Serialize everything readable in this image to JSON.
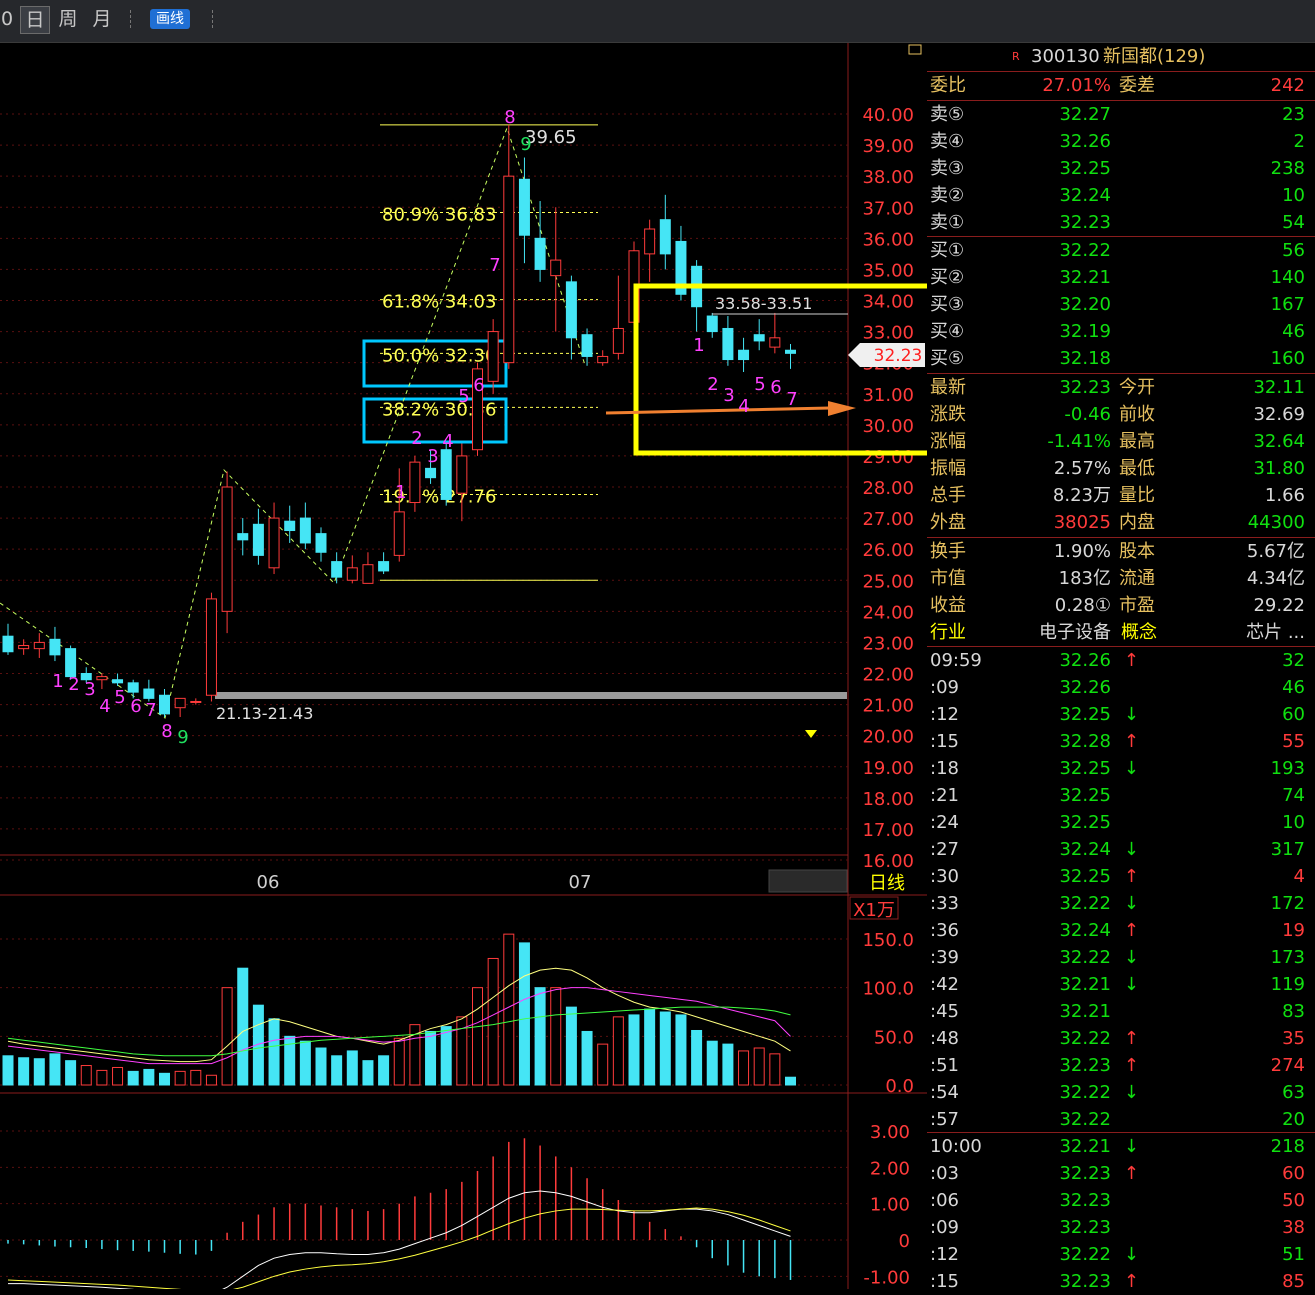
{
  "toolbar": {
    "left_fragment": "0",
    "day": "日",
    "week": "周",
    "month": "月",
    "draw": "画线"
  },
  "chart_data": [
    {
      "type": "candlestick",
      "title": "",
      "yaxis_ticks": [
        "40.00",
        "39.00",
        "38.00",
        "37.00",
        "36.00",
        "35.00",
        "34.00",
        "33.00",
        "32.00",
        "31.00",
        "30.00",
        "29.00",
        "28.00",
        "27.00",
        "26.00",
        "25.00",
        "24.00",
        "23.00",
        "22.00",
        "21.00",
        "20.00",
        "19.00",
        "18.00",
        "17.00",
        "16.00"
      ],
      "ylim": [
        16,
        40
      ],
      "xaxis_labels": [
        "06",
        "07"
      ],
      "period_label": "日线",
      "current_price": "32.23",
      "annotations": {
        "high": "39.65",
        "range_low": "21.13-21.43",
        "range_box": "33.58-33.51",
        "fib": [
          {
            "label": "80.9% 36.83",
            "value": 36.83
          },
          {
            "label": "61.8% 34.03",
            "value": 34.03
          },
          {
            "label": "50.0% 32.30",
            "value": 32.3
          },
          {
            "label": "38.2% 30.56",
            "value": 30.56
          },
          {
            "label": "19.1% 27.76",
            "value": 27.76
          }
        ],
        "count_a": [
          "1",
          "2",
          "3",
          "4",
          "5",
          "6",
          "7",
          "8",
          "9"
        ],
        "count_b": [
          "1",
          "2",
          "3",
          "4",
          "5",
          "6",
          "7",
          "8",
          "9"
        ],
        "count_c": [
          "1",
          "2",
          "3",
          "4",
          "5",
          "6",
          "7"
        ]
      },
      "candles": [
        {
          "o": 23.2,
          "h": 23.6,
          "l": 22.6,
          "c": 22.7
        },
        {
          "o": 22.8,
          "h": 23.1,
          "l": 22.6,
          "c": 22.9
        },
        {
          "o": 22.8,
          "h": 23.3,
          "l": 22.5,
          "c": 23.0
        },
        {
          "o": 23.1,
          "h": 23.5,
          "l": 22.4,
          "c": 22.6
        },
        {
          "o": 22.8,
          "h": 22.9,
          "l": 21.8,
          "c": 21.9
        },
        {
          "o": 22.0,
          "h": 22.2,
          "l": 21.7,
          "c": 21.8
        },
        {
          "o": 21.8,
          "h": 22.0,
          "l": 21.5,
          "c": 21.9
        },
        {
          "o": 21.8,
          "h": 22.0,
          "l": 21.6,
          "c": 21.7
        },
        {
          "o": 21.7,
          "h": 21.8,
          "l": 21.2,
          "c": 21.4
        },
        {
          "o": 21.5,
          "h": 21.8,
          "l": 21.1,
          "c": 21.2
        },
        {
          "o": 21.3,
          "h": 21.5,
          "l": 20.6,
          "c": 20.7
        },
        {
          "o": 20.9,
          "h": 21.2,
          "l": 20.6,
          "c": 21.2
        },
        {
          "o": 21.1,
          "h": 21.2,
          "l": 21.0,
          "c": 21.1
        },
        {
          "o": 21.3,
          "h": 24.6,
          "l": 21.1,
          "c": 24.4
        },
        {
          "o": 24.0,
          "h": 28.5,
          "l": 23.3,
          "c": 28.0
        },
        {
          "o": 26.5,
          "h": 27.0,
          "l": 25.8,
          "c": 26.3
        },
        {
          "o": 26.8,
          "h": 27.3,
          "l": 25.5,
          "c": 25.8
        },
        {
          "o": 25.4,
          "h": 27.5,
          "l": 25.2,
          "c": 27.0
        },
        {
          "o": 26.9,
          "h": 27.4,
          "l": 26.2,
          "c": 26.6
        },
        {
          "o": 27.0,
          "h": 27.5,
          "l": 26.0,
          "c": 26.2
        },
        {
          "o": 26.5,
          "h": 26.7,
          "l": 25.6,
          "c": 25.9
        },
        {
          "o": 25.6,
          "h": 25.9,
          "l": 24.9,
          "c": 25.1
        },
        {
          "o": 25.0,
          "h": 25.8,
          "l": 24.9,
          "c": 25.4
        },
        {
          "o": 24.9,
          "h": 25.9,
          "l": 24.9,
          "c": 25.5
        },
        {
          "o": 25.6,
          "h": 25.9,
          "l": 25.2,
          "c": 25.3
        },
        {
          "o": 25.8,
          "h": 28.6,
          "l": 25.6,
          "c": 27.2
        },
        {
          "o": 27.5,
          "h": 29.0,
          "l": 27.2,
          "c": 28.8
        },
        {
          "o": 28.6,
          "h": 29.2,
          "l": 28.1,
          "c": 28.3
        },
        {
          "o": 29.2,
          "h": 29.4,
          "l": 27.4,
          "c": 27.6
        },
        {
          "o": 27.8,
          "h": 29.4,
          "l": 26.9,
          "c": 29.0
        },
        {
          "o": 29.2,
          "h": 32.0,
          "l": 29.0,
          "c": 31.8
        },
        {
          "o": 31.4,
          "h": 33.4,
          "l": 31.0,
          "c": 33.0
        },
        {
          "o": 32.0,
          "h": 39.65,
          "l": 31.8,
          "c": 38.0
        },
        {
          "o": 37.9,
          "h": 38.6,
          "l": 35.2,
          "c": 36.1
        },
        {
          "o": 36.0,
          "h": 37.2,
          "l": 34.6,
          "c": 35.0
        },
        {
          "o": 34.8,
          "h": 37.0,
          "l": 33.0,
          "c": 35.3
        },
        {
          "o": 34.6,
          "h": 34.8,
          "l": 32.1,
          "c": 32.8
        },
        {
          "o": 32.9,
          "h": 33.1,
          "l": 31.9,
          "c": 32.2
        },
        {
          "o": 32.0,
          "h": 32.4,
          "l": 31.9,
          "c": 32.2
        },
        {
          "o": 32.3,
          "h": 34.8,
          "l": 32.1,
          "c": 33.1
        },
        {
          "o": 33.3,
          "h": 35.9,
          "l": 32.2,
          "c": 35.6
        },
        {
          "o": 35.5,
          "h": 36.6,
          "l": 34.6,
          "c": 36.3
        },
        {
          "o": 36.6,
          "h": 37.4,
          "l": 35.0,
          "c": 35.5
        },
        {
          "o": 35.9,
          "h": 36.4,
          "l": 34.0,
          "c": 34.2
        },
        {
          "o": 35.1,
          "h": 35.3,
          "l": 33.0,
          "c": 33.8
        },
        {
          "o": 33.5,
          "h": 33.6,
          "l": 32.8,
          "c": 33.0
        },
        {
          "o": 33.1,
          "h": 33.5,
          "l": 31.9,
          "c": 32.1
        },
        {
          "o": 32.4,
          "h": 32.8,
          "l": 31.7,
          "c": 32.1
        },
        {
          "o": 32.9,
          "h": 33.4,
          "l": 32.4,
          "c": 32.7
        },
        {
          "o": 32.5,
          "h": 33.6,
          "l": 32.3,
          "c": 32.8
        },
        {
          "o": 32.4,
          "h": 32.6,
          "l": 31.8,
          "c": 32.3
        }
      ]
    },
    {
      "type": "bar",
      "title": "",
      "unit_label": "X1万",
      "yaxis_ticks": [
        "150.0",
        "100.0",
        "50.0",
        "0.0"
      ],
      "ylim": [
        0,
        160
      ],
      "values": [
        30,
        28,
        27,
        32,
        25,
        20,
        15,
        18,
        14,
        16,
        12,
        14,
        15,
        10,
        100,
        120,
        82,
        68,
        50,
        45,
        38,
        30,
        35,
        25,
        30,
        48,
        62,
        55,
        60,
        70,
        100,
        130,
        155,
        146,
        100,
        100,
        80,
        55,
        42,
        70,
        72,
        78,
        75,
        72,
        56,
        45,
        42,
        35,
        38,
        32,
        8
      ],
      "up": [
        false,
        false,
        false,
        false,
        false,
        true,
        true,
        true,
        false,
        false,
        false,
        true,
        true,
        true,
        true,
        false,
        false,
        false,
        false,
        false,
        false,
        false,
        false,
        false,
        false,
        true,
        true,
        false,
        false,
        true,
        true,
        true,
        true,
        false,
        false,
        true,
        false,
        false,
        true,
        true,
        false,
        false,
        false,
        false,
        false,
        false,
        false,
        true,
        true,
        true,
        false
      ],
      "series": [
        {
          "values": [
            45,
            42,
            40,
            38,
            36,
            34,
            32,
            30,
            28,
            26,
            25,
            24,
            24,
            26,
            40,
            55,
            62,
            68,
            65,
            60,
            55,
            50,
            48,
            45,
            42,
            46,
            52,
            58,
            62,
            68,
            78,
            90,
            102,
            112,
            118,
            120,
            118,
            110,
            100,
            92,
            85,
            80,
            78,
            75,
            70,
            65,
            60,
            55,
            50,
            45,
            35
          ]
        },
        {
          "values": [
            40,
            38,
            36,
            34,
            32,
            30,
            28,
            26,
            24,
            22,
            22,
            22,
            22,
            22,
            28,
            36,
            42,
            46,
            48,
            50,
            50,
            50,
            48,
            46,
            44,
            45,
            48,
            50,
            54,
            58,
            64,
            72,
            80,
            88,
            94,
            98,
            100,
            100,
            98,
            96,
            94,
            92,
            90,
            88,
            86,
            82,
            78,
            74,
            70,
            66,
            50
          ]
        },
        {
          "values": [
            48,
            46,
            44,
            42,
            40,
            38,
            36,
            34,
            32,
            31,
            30,
            30,
            30,
            30,
            32,
            35,
            38,
            40,
            42,
            44,
            46,
            47,
            48,
            49,
            50,
            51,
            52,
            54,
            56,
            58,
            60,
            62,
            65,
            68,
            70,
            72,
            73,
            74,
            75,
            76,
            77,
            78,
            79,
            80,
            80,
            80,
            80,
            79,
            78,
            76,
            72
          ]
        }
      ]
    },
    {
      "type": "bar",
      "title": "",
      "yaxis_ticks": [
        "3.00",
        "2.00",
        "1.00",
        "0",
        "-1.00"
      ],
      "ylim": [
        -1.2,
        3.2
      ],
      "values": [
        -0.1,
        -0.12,
        -0.15,
        -0.18,
        -0.2,
        -0.22,
        -0.25,
        -0.28,
        -0.3,
        -0.32,
        -0.35,
        -0.38,
        -0.4,
        -0.3,
        0.2,
        0.5,
        0.7,
        0.9,
        1.0,
        1.0,
        0.95,
        0.9,
        0.85,
        0.8,
        0.85,
        1.0,
        1.2,
        1.3,
        1.4,
        1.6,
        1.9,
        2.3,
        2.7,
        2.8,
        2.6,
        2.3,
        2.0,
        1.7,
        1.4,
        1.1,
        0.8,
        0.5,
        0.3,
        0.1,
        -0.2,
        -0.5,
        -0.7,
        -0.9,
        -1.0,
        -1.05,
        -1.1
      ],
      "series": [
        {
          "values": [
            0.4,
            0.4,
            0.38,
            0.36,
            0.34,
            0.32,
            0.3,
            0.27,
            0.24,
            0.2,
            0.16,
            0.12,
            0.08,
            0.1,
            0.3,
            0.6,
            0.9,
            1.1,
            1.2,
            1.25,
            1.25,
            1.22,
            1.2,
            1.2,
            1.25,
            1.35,
            1.5,
            1.65,
            1.8,
            2.0,
            2.25,
            2.5,
            2.75,
            2.9,
            2.95,
            2.9,
            2.8,
            2.65,
            2.5,
            2.4,
            2.35,
            2.35,
            2.4,
            2.45,
            2.45,
            2.4,
            2.3,
            2.15,
            2.0,
            1.85,
            1.7
          ]
        },
        {
          "values": [
            0.5,
            0.48,
            0.46,
            0.44,
            0.42,
            0.4,
            0.38,
            0.36,
            0.33,
            0.3,
            0.27,
            0.24,
            0.2,
            0.18,
            0.2,
            0.3,
            0.45,
            0.6,
            0.72,
            0.8,
            0.86,
            0.9,
            0.92,
            0.95,
            1.0,
            1.08,
            1.18,
            1.3,
            1.42,
            1.55,
            1.7,
            1.88,
            2.05,
            2.2,
            2.32,
            2.4,
            2.45,
            2.45,
            2.44,
            2.42,
            2.4,
            2.4,
            2.42,
            2.45,
            2.48,
            2.45,
            2.38,
            2.28,
            2.15,
            2.0,
            1.85
          ]
        }
      ]
    }
  ],
  "quote": {
    "flag": "R",
    "code": "300130",
    "name": "新国都(129)",
    "webi_label": "委比",
    "webi": "27.01%",
    "weicha_label": "委差",
    "weicha": "242",
    "asks": [
      {
        "label": "卖⑤",
        "price": "32.27",
        "vol": "23"
      },
      {
        "label": "卖④",
        "price": "32.26",
        "vol": "2"
      },
      {
        "label": "卖③",
        "price": "32.25",
        "vol": "238"
      },
      {
        "label": "卖②",
        "price": "32.24",
        "vol": "10"
      },
      {
        "label": "卖①",
        "price": "32.23",
        "vol": "54"
      }
    ],
    "bids": [
      {
        "label": "买①",
        "price": "32.22",
        "vol": "56"
      },
      {
        "label": "买②",
        "price": "32.21",
        "vol": "140"
      },
      {
        "label": "买③",
        "price": "32.20",
        "vol": "167"
      },
      {
        "label": "买④",
        "price": "32.19",
        "vol": "46"
      },
      {
        "label": "买⑤",
        "price": "32.18",
        "vol": "160"
      }
    ],
    "stats": [
      {
        "l1": "最新",
        "v1": "32.23",
        "c1": "g",
        "l2": "今开",
        "v2": "32.11",
        "c2": "g"
      },
      {
        "l1": "涨跌",
        "v1": "-0.46",
        "c1": "g",
        "l2": "前收",
        "v2": "32.69",
        "c2": "w"
      },
      {
        "l1": "涨幅",
        "v1": "-1.41%",
        "c1": "g",
        "l2": "最高",
        "v2": "32.64",
        "c2": "g"
      },
      {
        "l1": "振幅",
        "v1": "2.57%",
        "c1": "w",
        "l2": "最低",
        "v2": "31.80",
        "c2": "g"
      },
      {
        "l1": "总手",
        "v1": "8.23万",
        "c1": "w",
        "l2": "量比",
        "v2": "1.66",
        "c2": "w"
      },
      {
        "l1": "外盘",
        "v1": "38025",
        "c1": "r",
        "l2": "内盘",
        "v2": "44300",
        "c2": "g"
      }
    ],
    "info": [
      {
        "l1": "换手",
        "v1": "1.90%",
        "l2": "股本",
        "v2": "5.67亿"
      },
      {
        "l1": "市值",
        "v1": "183亿",
        "l2": "流通",
        "v2": "4.34亿"
      },
      {
        "l1": "收益",
        "v1": "0.28①",
        "l2": "市盈",
        "v2": "29.22"
      }
    ],
    "industry_label": "行业",
    "industry": "电子设备",
    "concept_label": "概念",
    "concept": "芯片 ...",
    "ticks": [
      {
        "t": "09:59",
        "p": "32.26",
        "a": "↑",
        "v": "32",
        "vc": "g"
      },
      {
        "t": ":09",
        "p": "32.26",
        "a": "",
        "v": "46",
        "vc": "g"
      },
      {
        "t": ":12",
        "p": "32.25",
        "a": "↓",
        "v": "60",
        "vc": "g"
      },
      {
        "t": ":15",
        "p": "32.28",
        "a": "↑",
        "v": "55",
        "vc": "r"
      },
      {
        "t": ":18",
        "p": "32.25",
        "a": "↓",
        "v": "193",
        "vc": "g"
      },
      {
        "t": ":21",
        "p": "32.25",
        "a": "",
        "v": "74",
        "vc": "g"
      },
      {
        "t": ":24",
        "p": "32.25",
        "a": "",
        "v": "10",
        "vc": "g"
      },
      {
        "t": ":27",
        "p": "32.24",
        "a": "↓",
        "v": "317",
        "vc": "g"
      },
      {
        "t": ":30",
        "p": "32.25",
        "a": "↑",
        "v": "4",
        "vc": "r"
      },
      {
        "t": ":33",
        "p": "32.22",
        "a": "↓",
        "v": "172",
        "vc": "g"
      },
      {
        "t": ":36",
        "p": "32.24",
        "a": "↑",
        "v": "19",
        "vc": "r"
      },
      {
        "t": ":39",
        "p": "32.22",
        "a": "↓",
        "v": "173",
        "vc": "g"
      },
      {
        "t": ":42",
        "p": "32.21",
        "a": "↓",
        "v": "119",
        "vc": "g"
      },
      {
        "t": ":45",
        "p": "32.21",
        "a": "",
        "v": "83",
        "vc": "g"
      },
      {
        "t": ":48",
        "p": "32.22",
        "a": "↑",
        "v": "35",
        "vc": "r"
      },
      {
        "t": ":51",
        "p": "32.23",
        "a": "↑",
        "v": "274",
        "vc": "r"
      },
      {
        "t": ":54",
        "p": "32.22",
        "a": "↓",
        "v": "63",
        "vc": "g"
      },
      {
        "t": ":57",
        "p": "32.22",
        "a": "",
        "v": "20",
        "vc": "g"
      },
      {
        "t": "10:00",
        "p": "32.21",
        "a": "↓",
        "v": "218",
        "vc": "g"
      },
      {
        "t": ":03",
        "p": "32.23",
        "a": "↑",
        "v": "60",
        "vc": "r"
      },
      {
        "t": ":06",
        "p": "32.23",
        "a": "",
        "v": "50",
        "vc": "r"
      },
      {
        "t": ":09",
        "p": "32.23",
        "a": "",
        "v": "38",
        "vc": "r"
      },
      {
        "t": ":12",
        "p": "32.22",
        "a": "↓",
        "v": "51",
        "vc": "g"
      },
      {
        "t": ":15",
        "p": "32.23",
        "a": "↑",
        "v": "85",
        "vc": "r"
      }
    ]
  },
  "colors": {
    "up": "#ff3b3b",
    "down": "#45e5f5",
    "grid": "#5a1010",
    "fib": "#ffff55",
    "highlight": "#ffff00",
    "box": "#00c8ff",
    "arrow": "#f08030"
  }
}
